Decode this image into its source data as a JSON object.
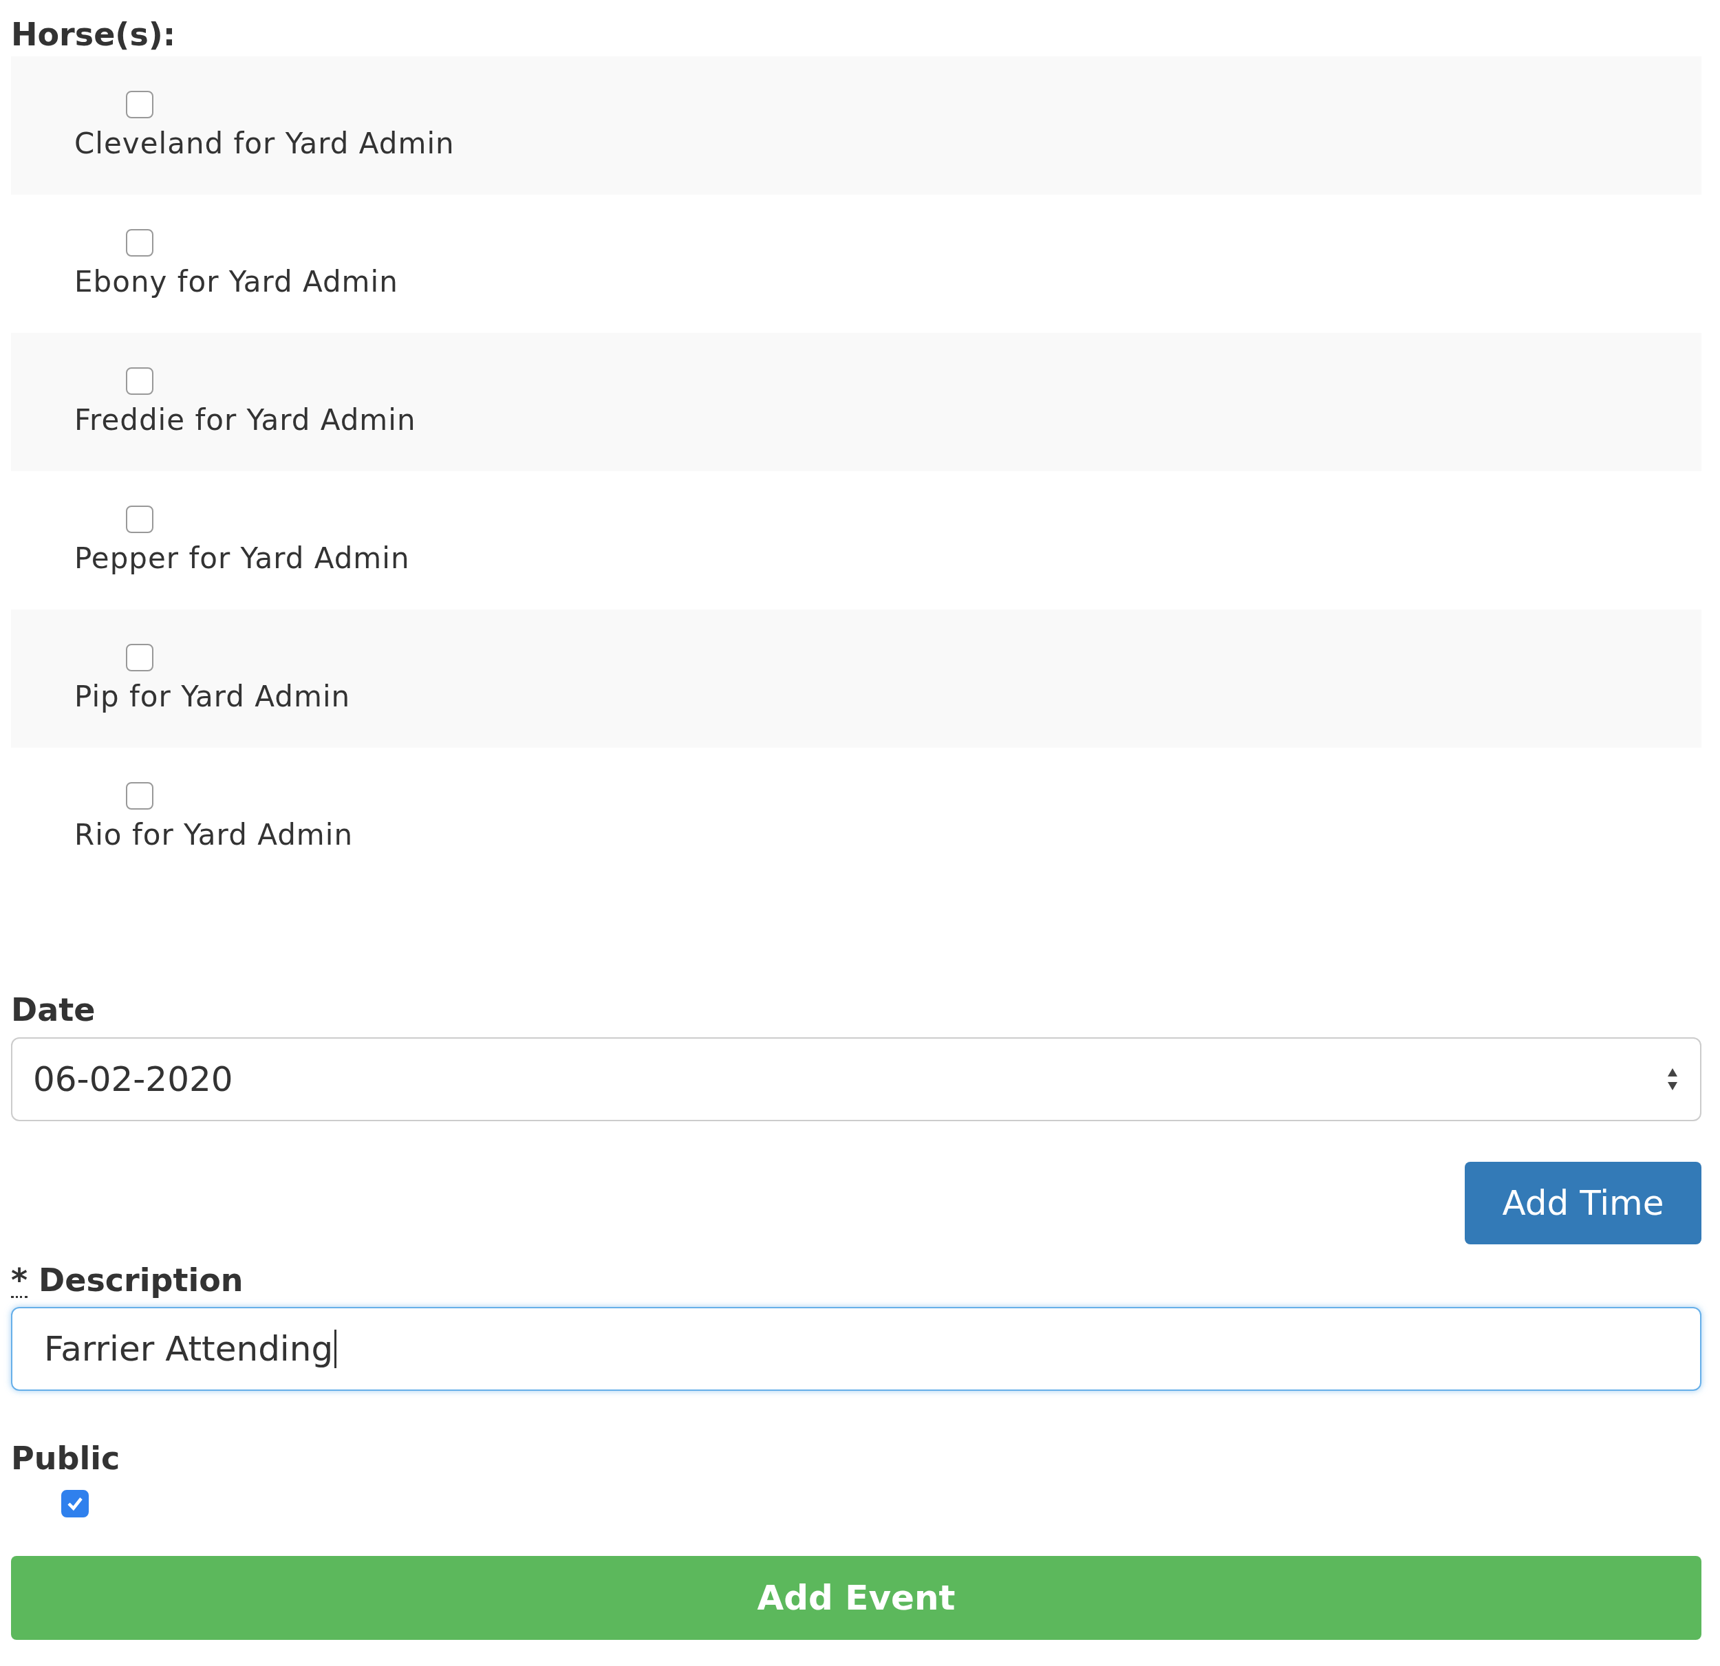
{
  "horses": {
    "label": "Horse(s):",
    "items": [
      {
        "name": "Cleveland for Yard Admin",
        "checked": false
      },
      {
        "name": "Ebony for Yard Admin",
        "checked": false
      },
      {
        "name": "Freddie for Yard Admin",
        "checked": false
      },
      {
        "name": "Pepper for Yard Admin",
        "checked": false
      },
      {
        "name": "Pip for Yard Admin",
        "checked": false
      },
      {
        "name": "Rio for Yard Admin",
        "checked": false
      }
    ]
  },
  "date": {
    "label": "Date",
    "value": "06-02-2020"
  },
  "add_time_button": "Add Time",
  "description": {
    "required_mark": "*",
    "label": "Description",
    "value": "Farrier Attending",
    "focused": true
  },
  "public": {
    "label": "Public",
    "checked": true
  },
  "add_event_button": "Add Event"
}
